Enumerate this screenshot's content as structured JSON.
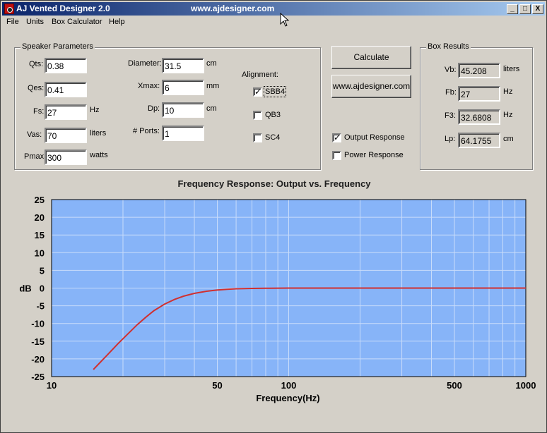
{
  "window": {
    "title": "AJ Vented Designer 2.0",
    "url_title": "www.ajdesigner.com",
    "controls": {
      "minimize": "_",
      "maximize": "□",
      "close": "X"
    }
  },
  "menu": [
    "File",
    "Units",
    "Box Calculator",
    "Help"
  ],
  "speaker_parameters": {
    "group_label": "Speaker Parameters",
    "qts": {
      "label": "Qts:",
      "value": "0.38"
    },
    "qes": {
      "label": "Qes:",
      "value": "0.41"
    },
    "fs": {
      "label": "Fs:",
      "value": "27",
      "unit": "Hz"
    },
    "vas": {
      "label": "Vas:",
      "value": "70",
      "unit": "liters"
    },
    "pmax": {
      "label": "Pmax:",
      "value": "300",
      "unit": "watts"
    },
    "diameter": {
      "label": "Diameter:",
      "value": "31.5",
      "unit": "cm"
    },
    "xmax": {
      "label": "Xmax:",
      "value": "6",
      "unit": "mm"
    },
    "dp": {
      "label": "Dp:",
      "value": "10",
      "unit": "cm"
    },
    "ports": {
      "label": "# Ports:",
      "value": "1"
    },
    "alignment": {
      "label": "Alignment:",
      "options": [
        {
          "label": "SBB4",
          "checked": true
        },
        {
          "label": "QB3",
          "checked": false
        },
        {
          "label": "SC4",
          "checked": false
        }
      ]
    }
  },
  "actions": {
    "calculate": "Calculate",
    "website": "www.ajdesigner.com",
    "output_response": {
      "label": "Output Response",
      "checked": true
    },
    "power_response": {
      "label": "Power Response",
      "checked": false
    }
  },
  "box_results": {
    "group_label": "Box Results",
    "vb": {
      "label": "Vb:",
      "value": "45.208",
      "unit": "liters"
    },
    "fb": {
      "label": "Fb:",
      "value": "27",
      "unit": "Hz"
    },
    "f3": {
      "label": "F3:",
      "value": "32.6808",
      "unit": "Hz"
    },
    "lp": {
      "label": "Lp:",
      "value": "64.1755",
      "unit": "cm"
    }
  },
  "chart_data": {
    "type": "line",
    "title": "Frequency Response: Output vs. Frequency",
    "xlabel": "Frequency(Hz)",
    "ylabel": "dB",
    "x_scale": "log",
    "xlim": [
      10,
      1000
    ],
    "ylim": [
      -25,
      25
    ],
    "x_tick_labels": [
      "10",
      "50",
      "100",
      "500",
      "1000"
    ],
    "y_ticks": [
      25,
      20,
      15,
      10,
      5,
      0,
      -5,
      -10,
      -15,
      -20,
      -25
    ],
    "grid": true,
    "colors": {
      "plot_bg": "#87b4f8",
      "line": "#d03030",
      "grid": "#c8dcfa"
    },
    "series": [
      {
        "x": [
          15,
          17,
          19,
          21,
          23,
          25,
          27,
          30,
          33,
          36,
          40,
          45,
          50,
          55,
          60,
          70,
          80,
          100,
          150,
          200,
          300,
          500,
          700,
          1000
        ],
        "y": [
          -23.0,
          -19.2,
          -15.8,
          -12.9,
          -10.3,
          -8.2,
          -6.4,
          -4.5,
          -3.2,
          -2.3,
          -1.5,
          -0.9,
          -0.55,
          -0.35,
          -0.2,
          -0.1,
          -0.05,
          0,
          0,
          0,
          0,
          0,
          0,
          0
        ]
      }
    ]
  }
}
